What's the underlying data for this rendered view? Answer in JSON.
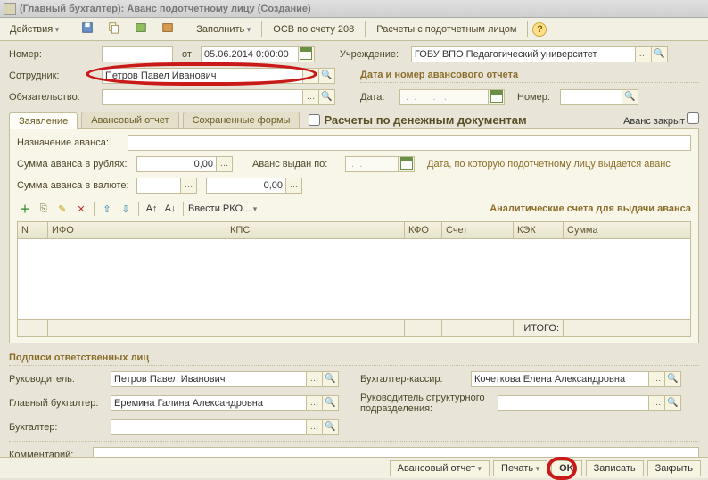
{
  "title": "(Главный бухгалтер): Аванс подотчетному лицу (Создание)",
  "toolbar": {
    "actions": "Действия",
    "fill": "Заполнить",
    "osv": "ОСВ по счету 208",
    "calc": "Расчеты с подотчетным лицом"
  },
  "header": {
    "number_label": "Номер:",
    "number": "",
    "from_label": "от",
    "date": "05.06.2014 0:00:00",
    "org_label": "Учреждение:",
    "org": "ГОБУ ВПО Педагогический университет",
    "employee_label": "Сотрудник:",
    "employee": "Петров Павел Иванович",
    "liability_label": "Обязательство:",
    "liability": "",
    "report_section": "Дата и номер авансового отчета",
    "report_date_label": "Дата:",
    "report_date": " .  .      :   :",
    "report_number_label": "Номер:",
    "report_number": ""
  },
  "tabs": {
    "t1": "Заявление",
    "t2": "Авансовый отчет",
    "t3": "Сохраненные формы",
    "chk_label": "Расчеты по денежным документам",
    "closed_label": "Аванс закрыт"
  },
  "adv": {
    "purpose_label": "Назначение аванса:",
    "purpose": "",
    "sum_rub_label": "Сумма аванса в рублях:",
    "sum_rub": "0,00",
    "issued_label": "Аванс выдан по:",
    "issued": " .  .",
    "issued_note": "Дата, по которую подотчетному лицу выдается аванс",
    "sum_cur_label": "Сумма аванса в валюте:",
    "sum_cur": "0,00",
    "enter_rko": "Ввести РКО...",
    "analytics": "Аналитические счета для выдачи аванса"
  },
  "grid": {
    "c0": "N",
    "c1": "ИФО",
    "c2": "КПС",
    "c3": "КФО",
    "c4": "Счет",
    "c5": "КЭК",
    "c6": "Сумма",
    "total": "ИТОГО:"
  },
  "signers": {
    "title": "Подписи ответственных лиц",
    "head_label": "Руководитель:",
    "head": "Петров Павел Иванович",
    "acc_cash_label": "Бухгалтер-кассир:",
    "acc_cash": "Кочеткова Елена Александровна",
    "chief_label": "Главный бухгалтер:",
    "chief": "Еремина Галина Александровна",
    "struct_head_label": "Руководитель структурного подразделения:",
    "struct_head": "",
    "accountant_label": "Бухгалтер:",
    "accountant": ""
  },
  "comment_label": "Комментарий:",
  "comment": "",
  "bottom": {
    "report": "Авансовый отчет",
    "print": "Печать",
    "ok": "OK",
    "save": "Записать",
    "close": "Закрыть"
  }
}
